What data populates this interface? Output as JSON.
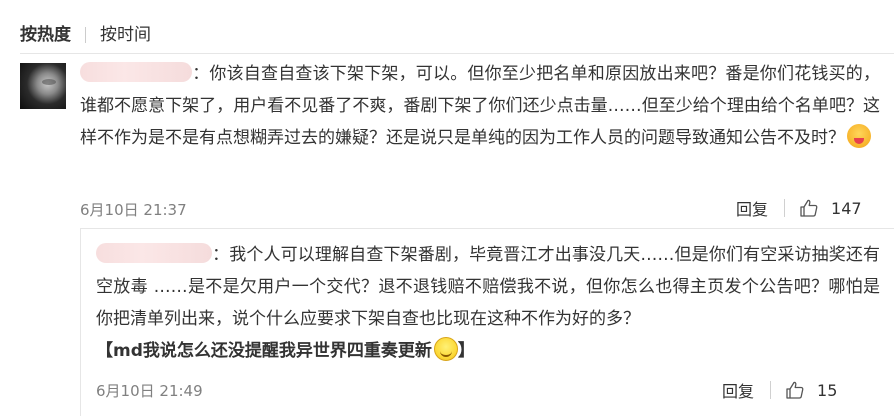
{
  "sort_tabs": {
    "active": "按热度",
    "inactive": "按时间"
  },
  "main_comment": {
    "text": "：你该自查自查该下架下架，可以。但你至少把名单和原因放出来吧？番是你们花钱买的，谁都不愿意下架了，用户看不见番了不爽，番剧下架了你们还少点击量……但至少给个理由给个名单吧？这样不作为是不是有点想糊弄过去的嫌疑？还是说只是单纯的因为工作人员的问题导致通知公告不及时？",
    "emoji": "drool-emoji",
    "timestamp": "6月10日 21:37",
    "reply_label": "回复",
    "like_count": "147"
  },
  "reply_comment": {
    "text": "：我个人可以理解自查下架番剧，毕竟晋江才出事没几天……但是你们有空采访抽奖还有空放毒 ……是不是欠用户一个交代？退不退钱赔不赔偿我不说，但你怎么也得主页发个公告吧？哪怕是你把清单列出来，说个什么应要求下架自查也比现在这种不作为好的多？",
    "quote": "【md我说怎么还没提醒我异世界四重奏更新",
    "quote_end": "】",
    "emoji": "smile-emoji",
    "timestamp": "6月10日 21:49",
    "reply_label": "回复",
    "like_count": "15"
  },
  "icons": {
    "like": "thumbs-up-icon"
  },
  "colors": {
    "text": "#333333",
    "meta": "#808080",
    "divider": "#e6e6e6",
    "masked_name": "#f7dede"
  }
}
